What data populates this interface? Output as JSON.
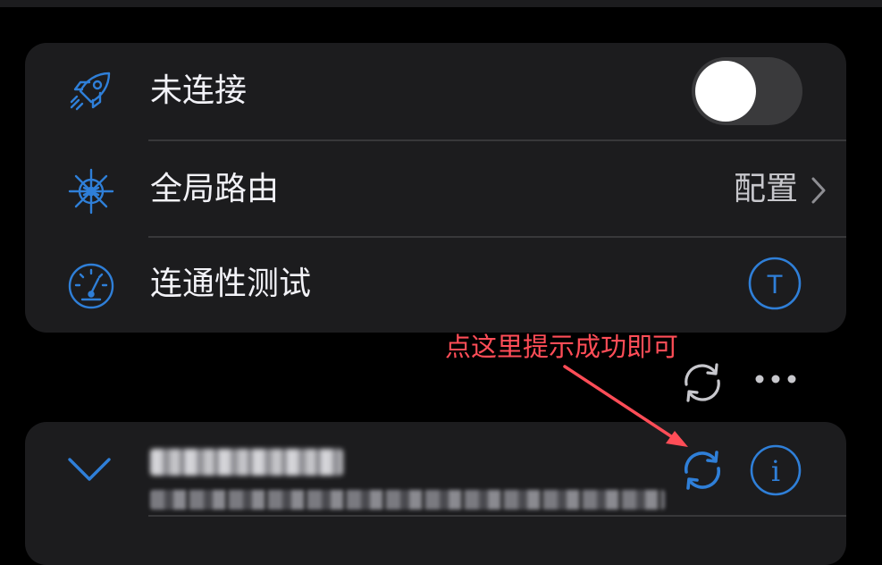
{
  "colors": {
    "background": "#000000",
    "card": "#1c1c1e",
    "accent_blue": "#2f7fd8",
    "annotation_red": "#ff4d57",
    "toggle_off": "#3a3a3c"
  },
  "settings": {
    "connection": {
      "icon": "rocket-icon",
      "label": "未连接",
      "toggle_on": false
    },
    "global_routing": {
      "icon": "ship-wheel-icon",
      "label": "全局路由",
      "value": "配置"
    },
    "connectivity_test": {
      "icon": "speedometer-icon",
      "label": "连通性测试",
      "action": "T"
    }
  },
  "annotation": {
    "text": "点这里提示成功即可"
  },
  "toolbar": {
    "refresh_icon": "refresh-icon",
    "more_icon": "more-icon"
  },
  "subscription": {
    "collapse_icon": "chevron-down-icon",
    "update_icon": "refresh-icon",
    "info_icon": "info-icon",
    "info_glyph": "i"
  }
}
